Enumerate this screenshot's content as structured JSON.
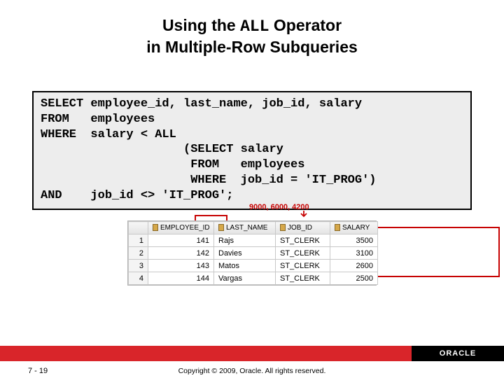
{
  "title": {
    "pre": "Using the ",
    "mono": "ALL",
    "post": " Operator\nin Multiple-Row Subqueries"
  },
  "code": {
    "l1": "SELECT employee_id, last_name, job_id, salary",
    "l2": "FROM   employees",
    "l3": "WHERE  salary < ALL",
    "l4": "                    (SELECT salary",
    "l5": "                     FROM   employees",
    "l6": "                     WHERE  job_id = 'IT_PROG')",
    "l7": "AND    job_id <> 'IT_PROG';"
  },
  "annot": "9000, 6000, 4200",
  "chart_data": {
    "type": "table",
    "title": "Query result",
    "columns": [
      "",
      "EMPLOYEE_ID",
      "LAST_NAME",
      "JOB_ID",
      "SALARY"
    ],
    "rows": [
      {
        "n": "1",
        "emp": "141",
        "ln": "Rajs",
        "job": "ST_CLERK",
        "sal": "3500"
      },
      {
        "n": "2",
        "emp": "142",
        "ln": "Davies",
        "job": "ST_CLERK",
        "sal": "3100"
      },
      {
        "n": "3",
        "emp": "143",
        "ln": "Matos",
        "job": "ST_CLERK",
        "sal": "2600"
      },
      {
        "n": "4",
        "emp": "144",
        "ln": "Vargas",
        "job": "ST_CLERK",
        "sal": "2500"
      }
    ]
  },
  "footer": {
    "page": "7 - 19",
    "copyright": "Copyright © 2009, Oracle. All rights reserved.",
    "brand": "ORACLE"
  }
}
